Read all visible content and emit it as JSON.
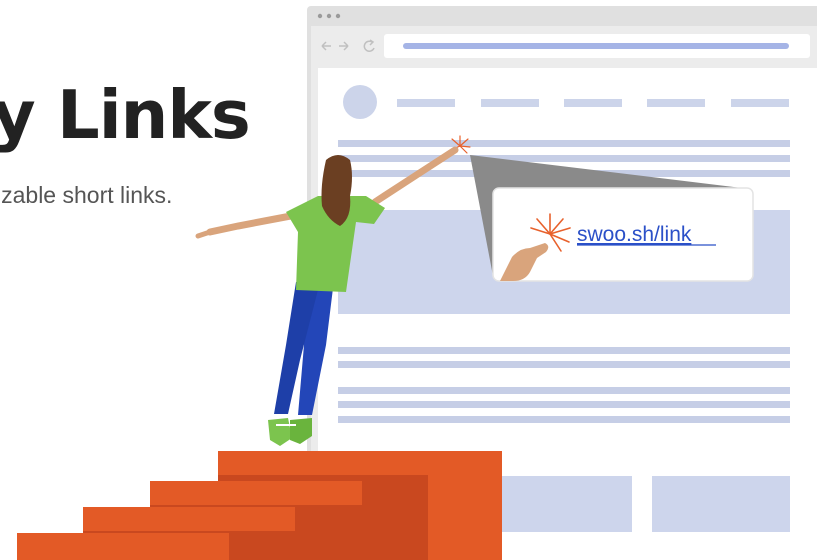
{
  "hero": {
    "title": "y Links",
    "subtitle": "izable short links."
  },
  "link_card": {
    "url": "swoo.sh/link"
  },
  "colors": {
    "title": "#222222",
    "subtitle": "#555555",
    "browser_frame": "#dcdcdc",
    "content_lines": "#c3cbe3",
    "link": "#2b50c8",
    "stairs": "#e25c24",
    "shirt": "#7cc44e",
    "jeans": "#2346b8"
  },
  "icons": [
    "back-arrow-icon",
    "forward-arrow-icon",
    "reload-icon",
    "sparkle-icon"
  ]
}
